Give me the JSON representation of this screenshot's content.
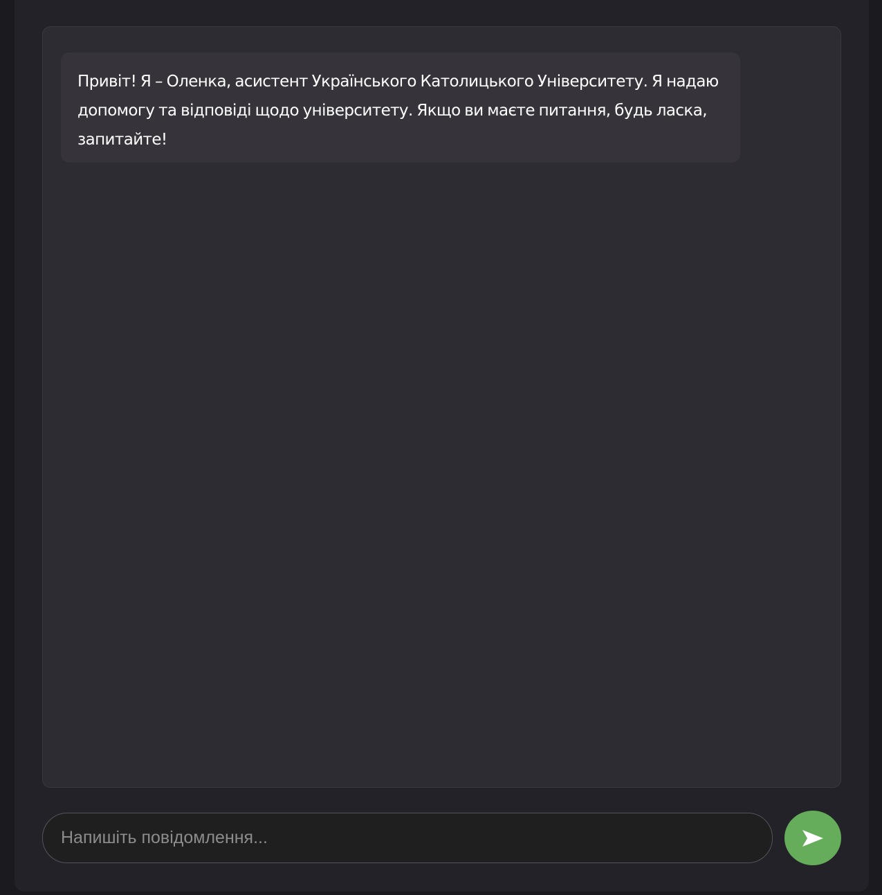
{
  "chat": {
    "messages": [
      {
        "role": "assistant",
        "text": "Привіт! Я – Оленка, асистент Українського Католицького Університету. Я надаю допомогу та відповіді щодо університету. Якщо ви маєте питання, будь ласка, запитайте!"
      }
    ]
  },
  "composer": {
    "placeholder": "Напишіть повідомлення...",
    "value": "",
    "send_icon": "send-arrow-icon"
  },
  "colors": {
    "page_background": "#1b1a1f",
    "panel_background": "#232228",
    "chat_background": "#2d2c33",
    "bubble_background": "#36333b",
    "input_background": "#1f1f1f",
    "send_button": "#66ad5b",
    "text": "#ffffff"
  }
}
